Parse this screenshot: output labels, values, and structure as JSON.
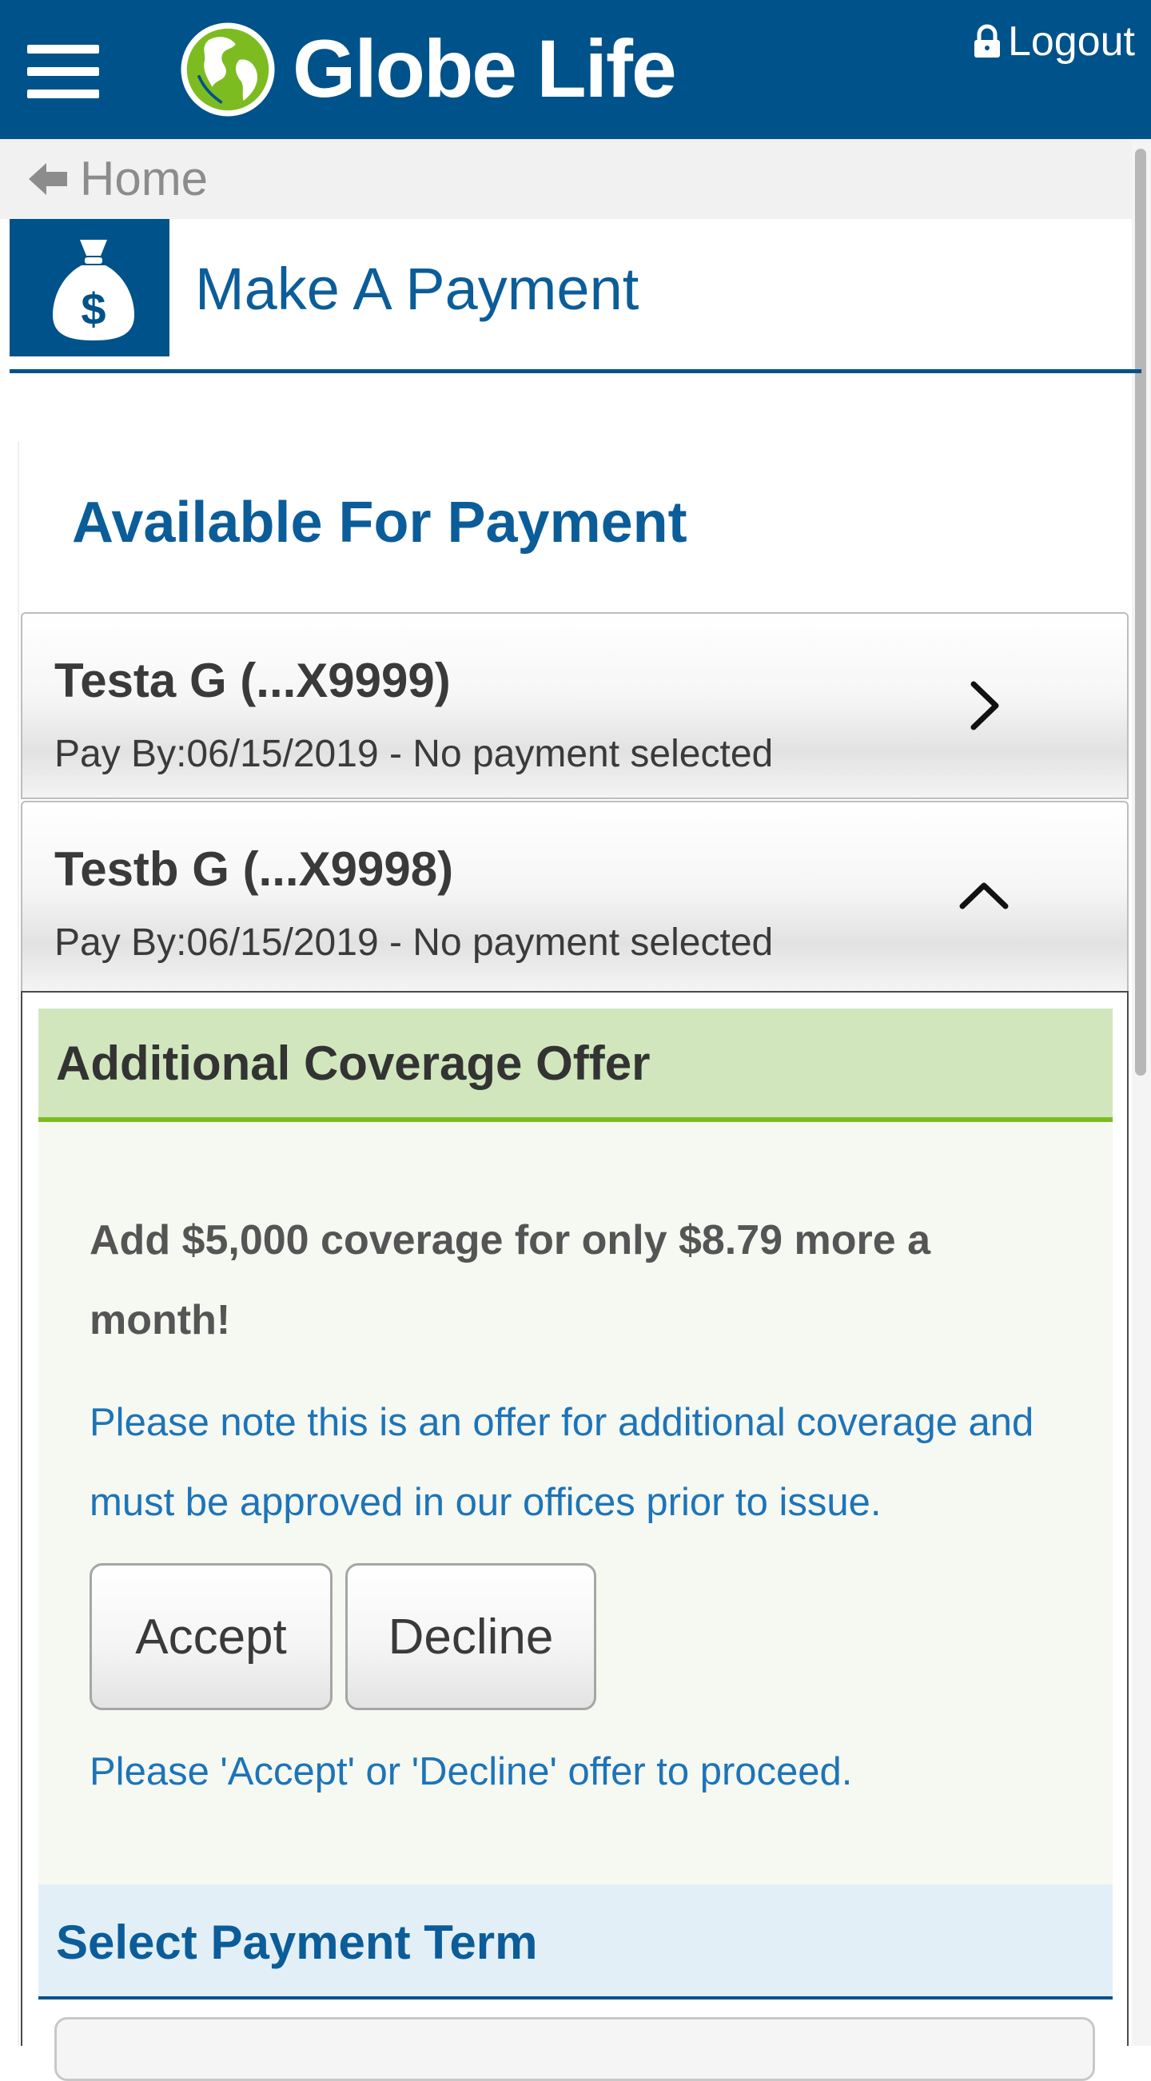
{
  "header": {
    "brand": "Globe Life",
    "logout_label": "Logout",
    "colors": {
      "bar": "#00528a",
      "globe": "#7cbc20"
    }
  },
  "breadcrumb": {
    "home_label": "Home"
  },
  "page": {
    "title": "Make A Payment",
    "icon": "money-bag-icon"
  },
  "available": {
    "heading": "Available For Payment",
    "policies": [
      {
        "name": "Testa G (...X9999)",
        "due": "Pay By:06/15/2019 - No payment selected",
        "expanded": false
      },
      {
        "name": "Testb G (...X9998)",
        "due": "Pay By:06/15/2019 - No payment selected",
        "expanded": true
      }
    ]
  },
  "offer": {
    "heading": "Additional Coverage Offer",
    "main": "Add $5,000 coverage for only $8.79 more a month!",
    "note": "Please note this is an offer for additional coverage and must be approved in our offices prior to issue.",
    "accept_label": "Accept",
    "decline_label": "Decline",
    "prompt": "Please 'Accept' or 'Decline' offer to proceed."
  },
  "payment_term": {
    "heading": "Select Payment Term"
  }
}
